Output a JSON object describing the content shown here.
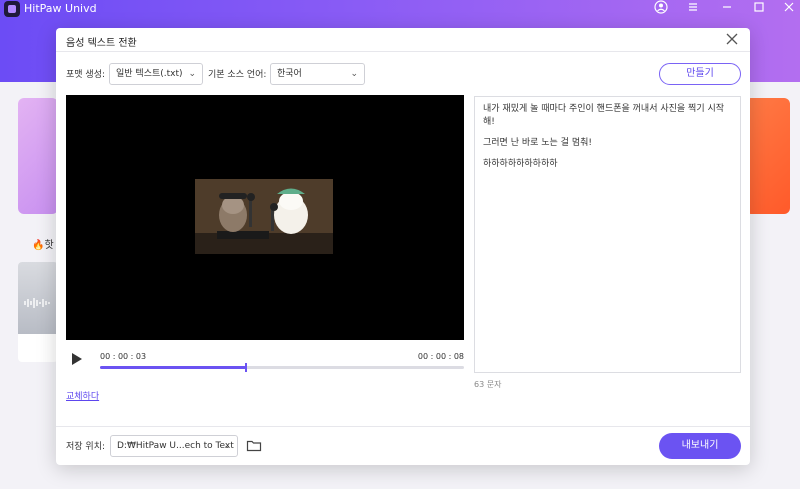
{
  "app": {
    "title": "HitPaw Univd"
  },
  "background": {
    "hot_label": "🔥핫"
  },
  "dialog": {
    "title": "음성 텍스트 전환",
    "format_label": "포맷 생성:",
    "format_value": "일반 텍스트(.txt)",
    "language_label": "기본 소스 언어:",
    "language_value": "한국어",
    "make_button": "만들기",
    "player": {
      "current_time": "00 : 00 : 03",
      "total_time": "00 : 00 : 08",
      "progress": 0.4
    },
    "replace_link": "교체하다",
    "transcript": [
      "내가 재밌게 놀 때마다 주인이 핸드폰을 꺼내서 사진을 찍기 시작해!",
      "그러면 난 바로 노는 걸 멈춰!",
      "하하하하하하하하하"
    ],
    "char_count": "63 문자",
    "save_label": "저장 위치:",
    "save_path": "D:₩HitPaw U...ech to Text",
    "export_button": "내보내기"
  },
  "colors": {
    "accent": "#6b53f2",
    "header_gradient_start": "#6c4cf5",
    "header_gradient_end": "#b36ef0"
  }
}
